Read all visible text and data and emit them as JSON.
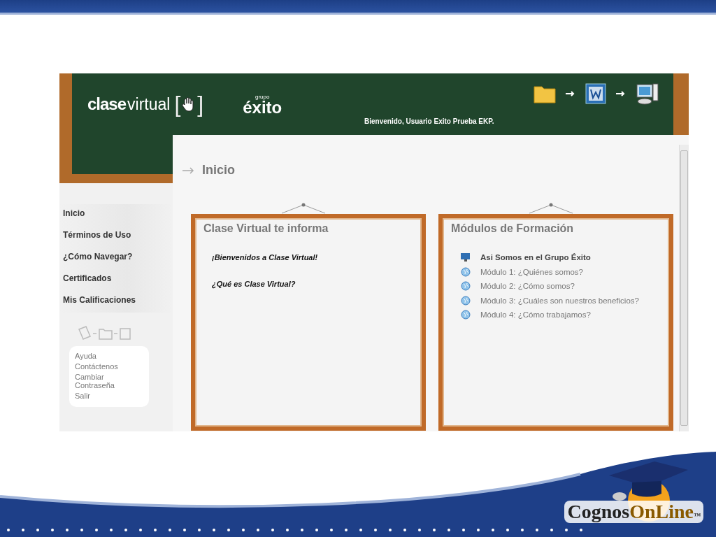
{
  "header": {
    "brand_bold": "clase",
    "brand_light": "virtual",
    "bracket_open": "[",
    "bracket_close": "]",
    "partner_small": "grupo",
    "partner_name": "éxito",
    "welcome": "Bienvenido, Usuario Exito Prueba EKP."
  },
  "sidebar": {
    "items": [
      {
        "label": "Inicio"
      },
      {
        "label": "Términos de Uso"
      },
      {
        "label": "¿Cómo Navegar?"
      },
      {
        "label": "Certificados"
      },
      {
        "label": "Mis Calificaciones"
      }
    ],
    "links": [
      "Ayuda",
      "Contáctenos",
      "Cambiar Contraseña",
      "Salir"
    ]
  },
  "page_title": "Inicio",
  "cards": [
    {
      "title": "Clase Virtual te informa",
      "items": [
        {
          "kind": "heading",
          "label": "¡Bienvenidos a Clase Virtual!"
        },
        {
          "kind": "heading",
          "label": "¿Qué es Clase Virtual?"
        }
      ]
    },
    {
      "title": "Módulos de Formación",
      "items": [
        {
          "kind": "course",
          "label": "Asi Somos en el Grupo Éxito"
        },
        {
          "kind": "module",
          "label": "Módulo 1: ¿Quiénes somos?"
        },
        {
          "kind": "module",
          "label": "Módulo 2: ¿Cómo somos?"
        },
        {
          "kind": "module",
          "label": "Módulo 3: ¿Cuáles son nuestros beneficios?"
        },
        {
          "kind": "module",
          "label": "Módulo 4: ¿Cómo trabajamos?"
        }
      ]
    }
  ],
  "slide_logo": {
    "part1": "Cognos",
    "part2": "OnLine",
    "mark": "™"
  }
}
